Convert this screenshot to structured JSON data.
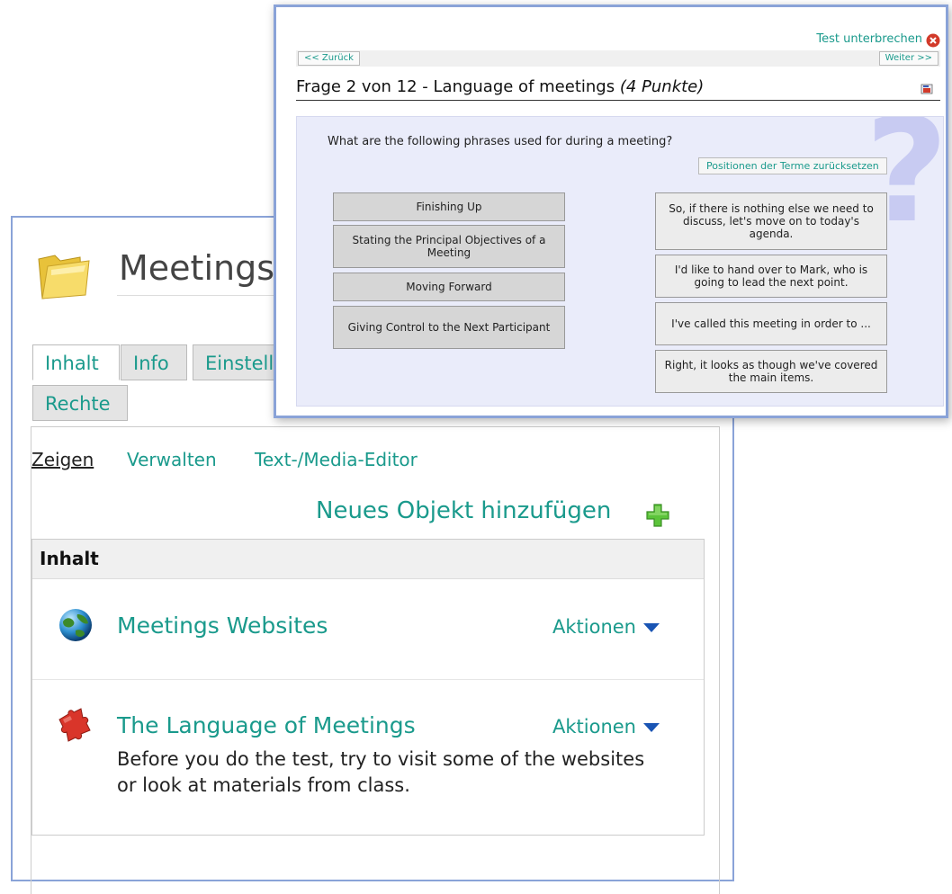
{
  "back": {
    "title": "Meetings",
    "tabs": [
      "Inhalt",
      "Info",
      "Einstellu",
      "Rechte"
    ],
    "subtabs": [
      "Zeigen",
      "Verwalten",
      "Text-/Media-Editor"
    ],
    "add_object": "Neues Objekt hinzufügen",
    "inhalt_header": "Inhalt",
    "items": [
      {
        "title": "Meetings Websites",
        "actions": "Aktionen",
        "icon": "globe-icon"
      },
      {
        "title": "The Language of Meetings",
        "actions": "Aktionen",
        "icon": "puzzle-icon",
        "description": "Before you do the test, try to visit some of the websites or look at materials from class."
      }
    ]
  },
  "front": {
    "test_stop": "Test unterbrechen",
    "back_button": "<< Zurück",
    "next_button": "Weiter >>",
    "question_title": "Frage 2 von 12 - Language of meetings",
    "points": "(4 Punkte)",
    "question_mark": "?",
    "prompt": "What are the following phrases used for during a meeting?",
    "reset_button": "Positionen der Terme zurücksetzen",
    "terms": [
      "Finishing Up",
      "Stating the Principal Objectives of a Meeting",
      "Moving Forward",
      "Giving Control to the Next Participant"
    ],
    "definitions": [
      "So, if there is nothing else we need to discuss, let's move on to today's agenda.",
      "I'd like to hand over to Mark, who is going to lead the next point.",
      "I've called this meeting in order to ...",
      "Right, it looks as though we've covered the main items."
    ]
  },
  "colors": {
    "link": "#1a9a8c",
    "window_border": "#8aa3d8",
    "question_bg": "#eaecfa",
    "plus": "#5cc43a",
    "caret": "#1a55b4"
  }
}
